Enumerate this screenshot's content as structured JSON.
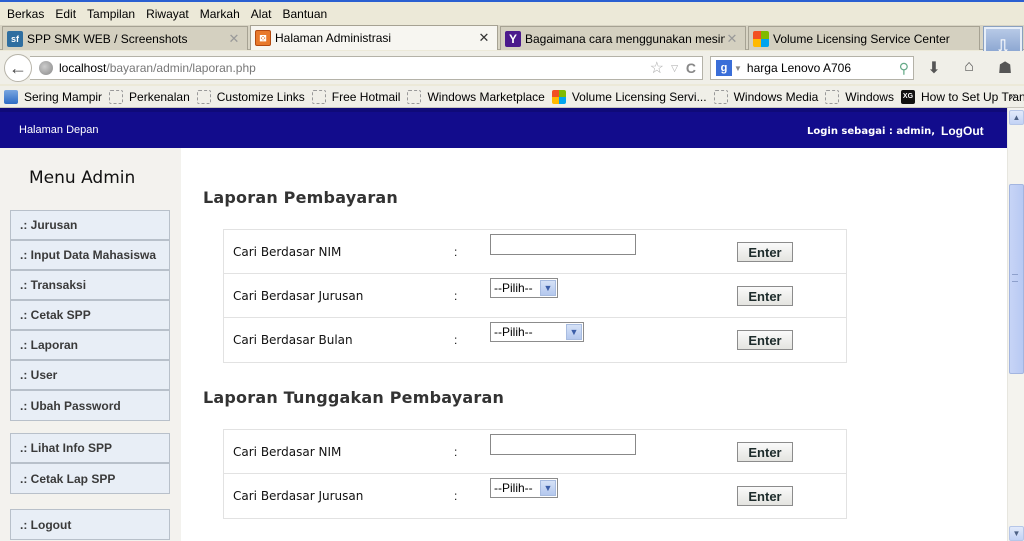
{
  "menubar": {
    "items": [
      {
        "label": "Berkas",
        "accel": "B"
      },
      {
        "label": "Edit",
        "accel": "E"
      },
      {
        "label": "Tampilan",
        "accel": "T"
      },
      {
        "label": "Riwayat",
        "accel": "R"
      },
      {
        "label": "Markah",
        "accel": "M"
      },
      {
        "label": "Alat",
        "accel": "A"
      },
      {
        "label": "Bantuan",
        "accel": "n"
      }
    ]
  },
  "tabs": [
    {
      "title": "SPP SMK WEB / Screenshots",
      "icon": "sourceforge-icon",
      "active": false
    },
    {
      "title": "Halaman Administrasi",
      "icon": "xampp-icon",
      "active": true
    },
    {
      "title": "Bagaimana cara menggunakan mesin cuci...",
      "icon": "yahoo-icon",
      "active": false
    },
    {
      "title": "Volume Licensing Service Center",
      "icon": "microsoft-icon",
      "active": false
    }
  ],
  "navbar": {
    "url_host": "localhost",
    "url_path": "/bayaran/admin/laporan.php",
    "search_value": "harga Lenovo A706"
  },
  "bookmarks": [
    {
      "label": "Sering Mampir",
      "icon": "blue"
    },
    {
      "label": "Perkenalan",
      "icon": "blank"
    },
    {
      "label": "Customize Links",
      "icon": "blank"
    },
    {
      "label": "Free Hotmail",
      "icon": "blank"
    },
    {
      "label": "Windows Marketplace",
      "icon": "blank"
    },
    {
      "label": "Volume Licensing Servi...",
      "icon": "ms"
    },
    {
      "label": "Windows Media",
      "icon": "blank"
    },
    {
      "label": "Windows",
      "icon": "blank"
    },
    {
      "label": "How to Set Up Transp...",
      "icon": "xg"
    }
  ],
  "bookmarks_more": "»",
  "header": {
    "home_link": "Halaman Depan",
    "login_text": "Login sebagai : admin,",
    "logout_link": "LogOut"
  },
  "sidebar": {
    "title": "Menu Admin",
    "groups": [
      [
        ".: Jurusan",
        ".: Input Data Mahasiswa",
        ".: Transaksi",
        ".: Cetak SPP",
        ".: Laporan",
        ".: User",
        ".: Ubah Password"
      ],
      [
        ".: Lihat Info SPP",
        ".: Cetak Lap SPP"
      ],
      [
        ".: Logout"
      ]
    ]
  },
  "sections": [
    {
      "title": "Laporan Pembayaran",
      "rows": [
        {
          "label": "Cari Berdasar NIM",
          "colon": ":",
          "type": "text",
          "value": "",
          "button": "Enter"
        },
        {
          "label": "Cari Berdasar Jurusan",
          "colon": ":",
          "type": "select",
          "value": "--Pilih--",
          "button": "Enter"
        },
        {
          "label": "Cari Berdasar Bulan",
          "colon": ":",
          "type": "select-wide",
          "value": "--Pilih--",
          "button": "Enter"
        }
      ]
    },
    {
      "title": "Laporan Tunggakan Pembayaran",
      "rows": [
        {
          "label": "Cari Berdasar NIM",
          "colon": ":",
          "type": "text",
          "value": "",
          "button": "Enter"
        },
        {
          "label": "Cari Berdasar Jurusan",
          "colon": ":",
          "type": "select",
          "value": "--Pilih--",
          "button": "Enter"
        }
      ]
    }
  ],
  "scroll": {
    "position_fraction": 0.2
  }
}
